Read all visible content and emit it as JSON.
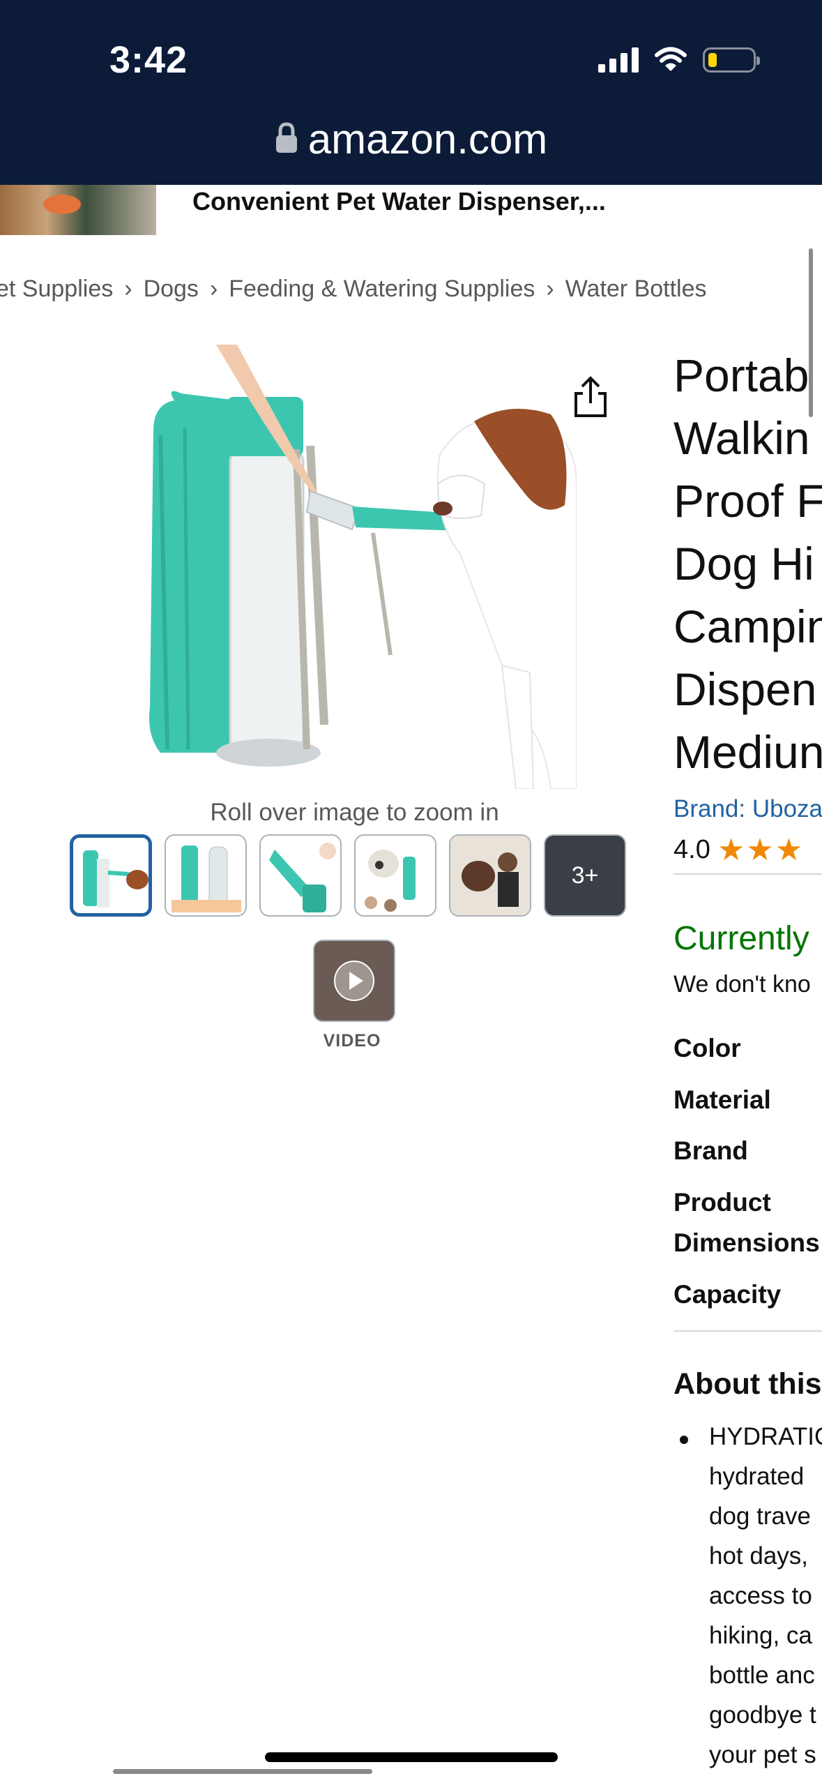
{
  "status_bar": {
    "time": "3:42"
  },
  "browser": {
    "url": "amazon.com"
  },
  "sticky_header": {
    "title": "Convenient Pet Water Dispenser,..."
  },
  "breadcrumb": [
    "et Supplies",
    "Dogs",
    "Feeding & Watering Supplies",
    "Water Bottles"
  ],
  "gallery": {
    "zoom_hint": "Roll over image to zoom in",
    "more_label": "3+",
    "video_label": "VIDEO"
  },
  "product": {
    "title_lines": [
      "Portab",
      "Walkin",
      "Proof F",
      "Dog Hi",
      "Campin",
      "Dispen",
      "Mediun"
    ],
    "brand": "Brand: Uboza",
    "rating": "4.0",
    "stars": "★★★"
  },
  "availability": {
    "status": "Currently",
    "note": "We don't kno"
  },
  "specs": [
    "Color",
    "Material",
    "Brand",
    "Product",
    "Dimensions",
    "Capacity"
  ],
  "about": {
    "heading": "About this",
    "bullet_lines": [
      "HYDRATIC",
      "hydrated",
      "dog trave",
      "hot days,",
      "access to",
      "hiking, ca",
      "bottle anc",
      "goodbye t",
      "your pet s"
    ]
  },
  "colors": {
    "topbar": "#0b1b38",
    "link": "#2162a1",
    "available": "#007600",
    "star": "#f08804",
    "bottle": "#3cc6b0"
  }
}
